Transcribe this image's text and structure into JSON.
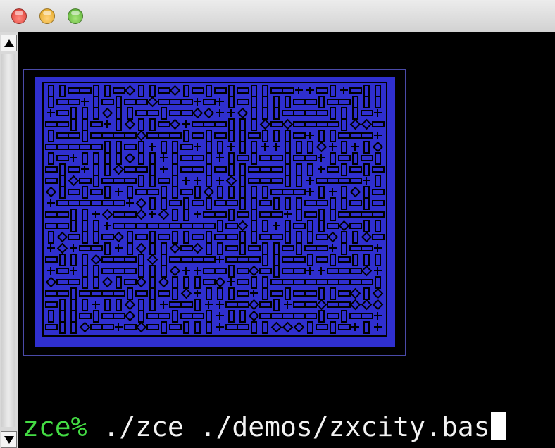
{
  "window": {
    "buttons": [
      "close",
      "minimize",
      "zoom"
    ],
    "colors": {
      "close": "#e2463c",
      "minimize": "#f0b233",
      "zoom": "#62c23b"
    }
  },
  "scrollbar": {
    "up_icon": "triangle-up-icon",
    "down_icon": "triangle-down-icon"
  },
  "emulator_screen": {
    "paper_color": "#2f2fcf",
    "ink_color": "#000000",
    "border_color": "#000000",
    "content": "procedurally generated city-map maze pattern"
  },
  "terminal": {
    "prompt": "zce%",
    "command": " ./zce ./demos/zxcity.bas",
    "prompt_color": "#44dd44",
    "text_color": "#f2f2f2"
  }
}
